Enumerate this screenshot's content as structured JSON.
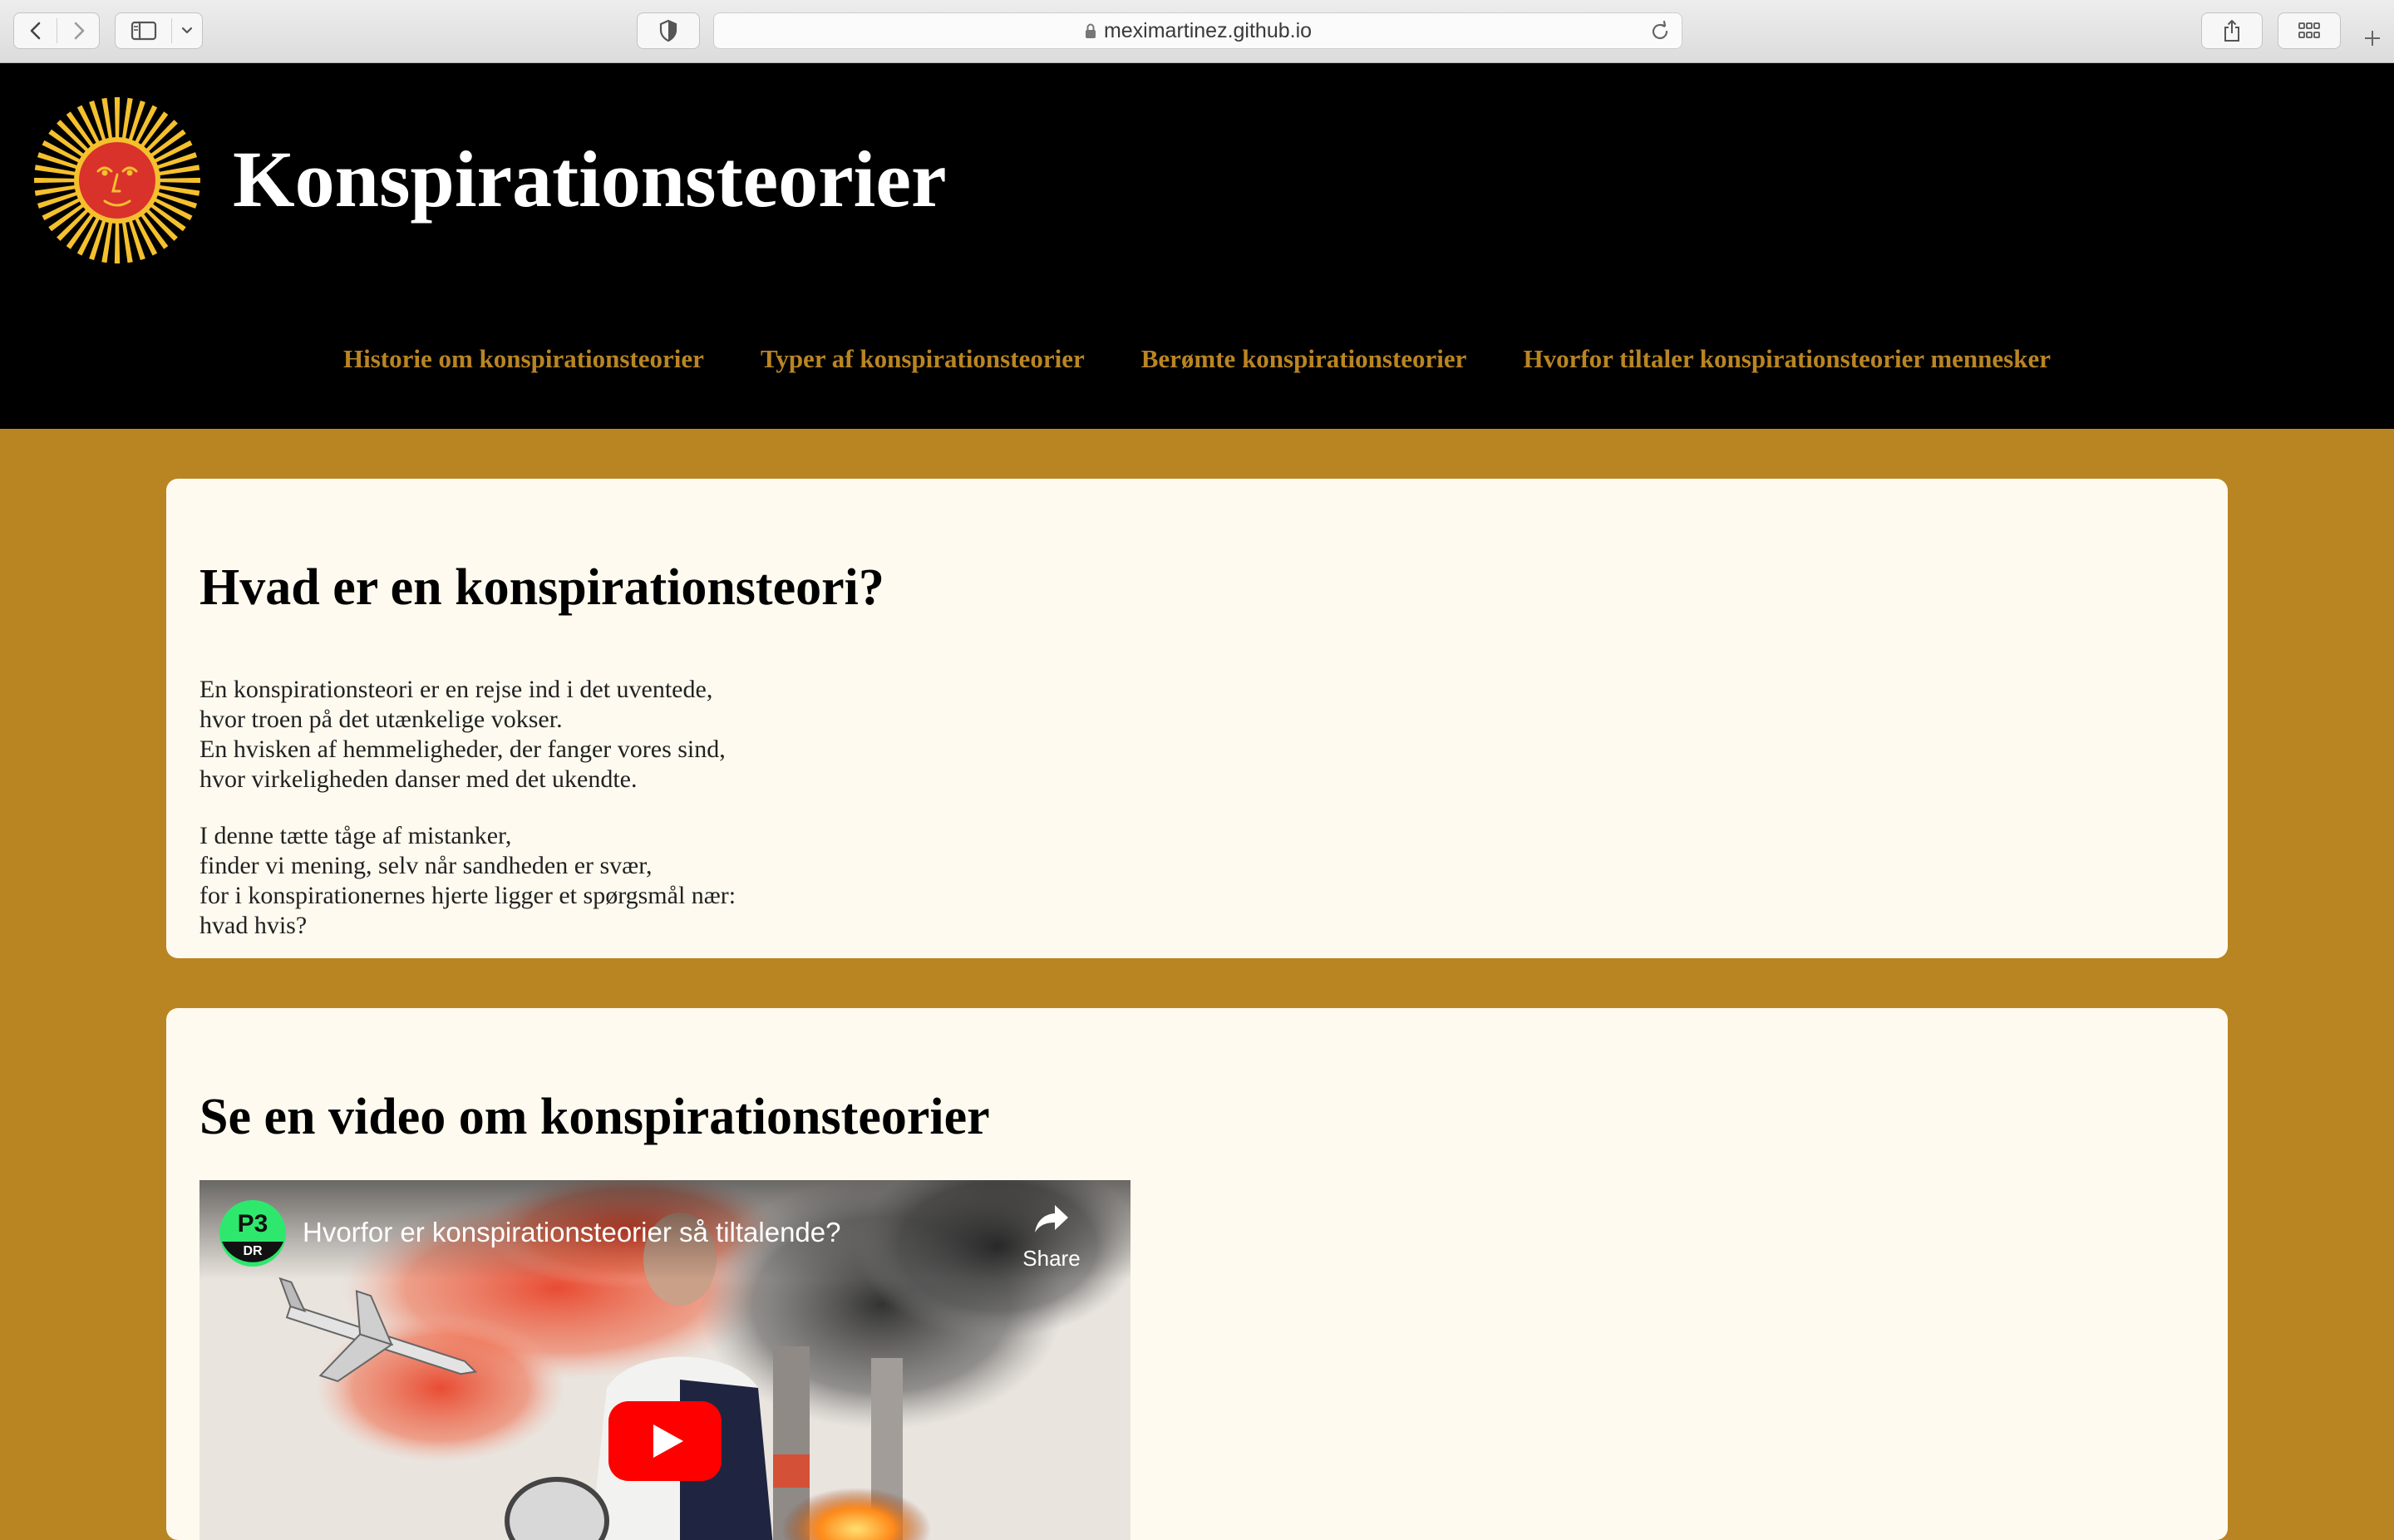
{
  "browser": {
    "url": "meximartinez.github.io"
  },
  "site": {
    "title": "Konspirationsteorier",
    "nav": [
      "Historie om konspirationsteorier",
      "Typer af konspirationsteorier",
      "Berømte konspirationsteorier",
      "Hvorfor tiltaler konspirationsteorier mennesker"
    ]
  },
  "section1": {
    "heading": "Hvad er en konspirationsteori?",
    "stanza1": [
      "En konspirationsteori er en rejse ind i det uventede,",
      "hvor troen på det utænkelige vokser.",
      "En hvisken af hemmeligheder, der fanger vores sind,",
      "hvor virkeligheden danser med det ukendte."
    ],
    "stanza2": [
      "I denne tætte tåge af mistanker,",
      "finder vi mening, selv når sandheden er svær,",
      "for i konspirationernes hjerte ligger et spørgsmål nær:",
      "hvad hvis?"
    ]
  },
  "section2": {
    "heading": "Se en video om konspirationsteorier",
    "video": {
      "title": "Hvorfor er konspirationsteorier så tiltalende?",
      "share_label": "Share",
      "channel_top": "P3",
      "channel_bottom": "DR"
    }
  },
  "colors": {
    "accent": "#b98523",
    "header_bg": "#000000",
    "card_bg": "#fffaef",
    "play_red": "#ff0000"
  }
}
